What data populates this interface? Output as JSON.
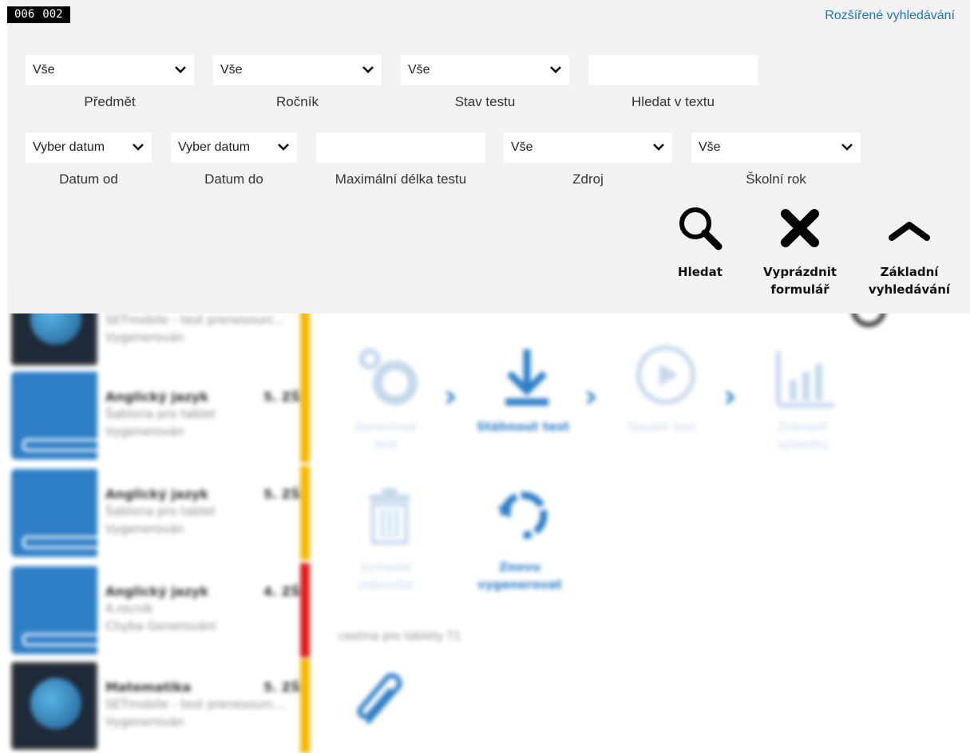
{
  "header": {
    "counter": [
      "006",
      "002"
    ],
    "advanced_search_link": "Rozšířené vyhledávání"
  },
  "filters": {
    "row1": [
      {
        "value": "Vše",
        "label": "Předmět"
      },
      {
        "value": "Vše",
        "label": "Ročník"
      },
      {
        "value": "Vše",
        "label": "Stav testu"
      },
      {
        "value": "",
        "label": "Hledat v textu"
      }
    ],
    "row2": [
      {
        "value": "Vyber datum",
        "label": "Datum od"
      },
      {
        "value": "Vyber datum",
        "label": "Datum do"
      },
      {
        "value": "",
        "label": "Maximální délka testu"
      },
      {
        "value": "Vše",
        "label": "Zdroj"
      },
      {
        "value": "Vše",
        "label": "Školní rok"
      }
    ]
  },
  "actions": {
    "search": "Hledat",
    "clear_line1": "Vyprázdnit",
    "clear_line2": "formulář",
    "basic_line1": "Základní",
    "basic_line2": "vyhledávání"
  },
  "list": [
    {
      "subject": "",
      "grade": "",
      "line2": "SETmobile - test prenesourc...",
      "line3": "Vygenerován",
      "bar_color": "#f5b800",
      "thumb": "globe"
    },
    {
      "subject": "Anglický jazyk",
      "grade": "5. ZŠ",
      "line2": "Šablona pro tablet",
      "line3": "Vygenerován",
      "bar_color": "#f5b800",
      "thumb": "book"
    },
    {
      "subject": "Anglický jazyk",
      "grade": "5. ZŠ",
      "line2": "Šablona pro tablet",
      "line3": "Vygenerován",
      "bar_color": "#f5b800",
      "thumb": "book"
    },
    {
      "subject": "Anglický jazyk",
      "grade": "4. ZŠ",
      "line2": "4.rocnik",
      "line3": "Chyba Generování",
      "bar_color": "#e01b1b",
      "thumb": "book"
    },
    {
      "subject": "Matematika",
      "grade": "5. ZŠ",
      "line2": "SETmobile - test prenesourc...",
      "line3": "Vygenerován",
      "bar_color": "#f5b800",
      "thumb": "globe"
    }
  ],
  "workflow": {
    "generate_line1": "Generovat",
    "generate_line2": "test",
    "download": "Stáhnout test",
    "run": "Spustit test",
    "results_line1": "Zobrazit",
    "results_line2": "výsledky",
    "delete_line1": "Vymazat",
    "delete_line2": "odpovědi",
    "regenerate_line1": "Znovu",
    "regenerate_line2": "vygenerovat",
    "test_name": "cestina pro tablety T1"
  },
  "colors": {
    "accent": "#2f7fc7",
    "inactive": "#c5d8ec",
    "panel_bg": "#f2f2f2",
    "status_ok": "#f5b800",
    "status_error": "#e01b1b",
    "link": "#1b76bd"
  }
}
